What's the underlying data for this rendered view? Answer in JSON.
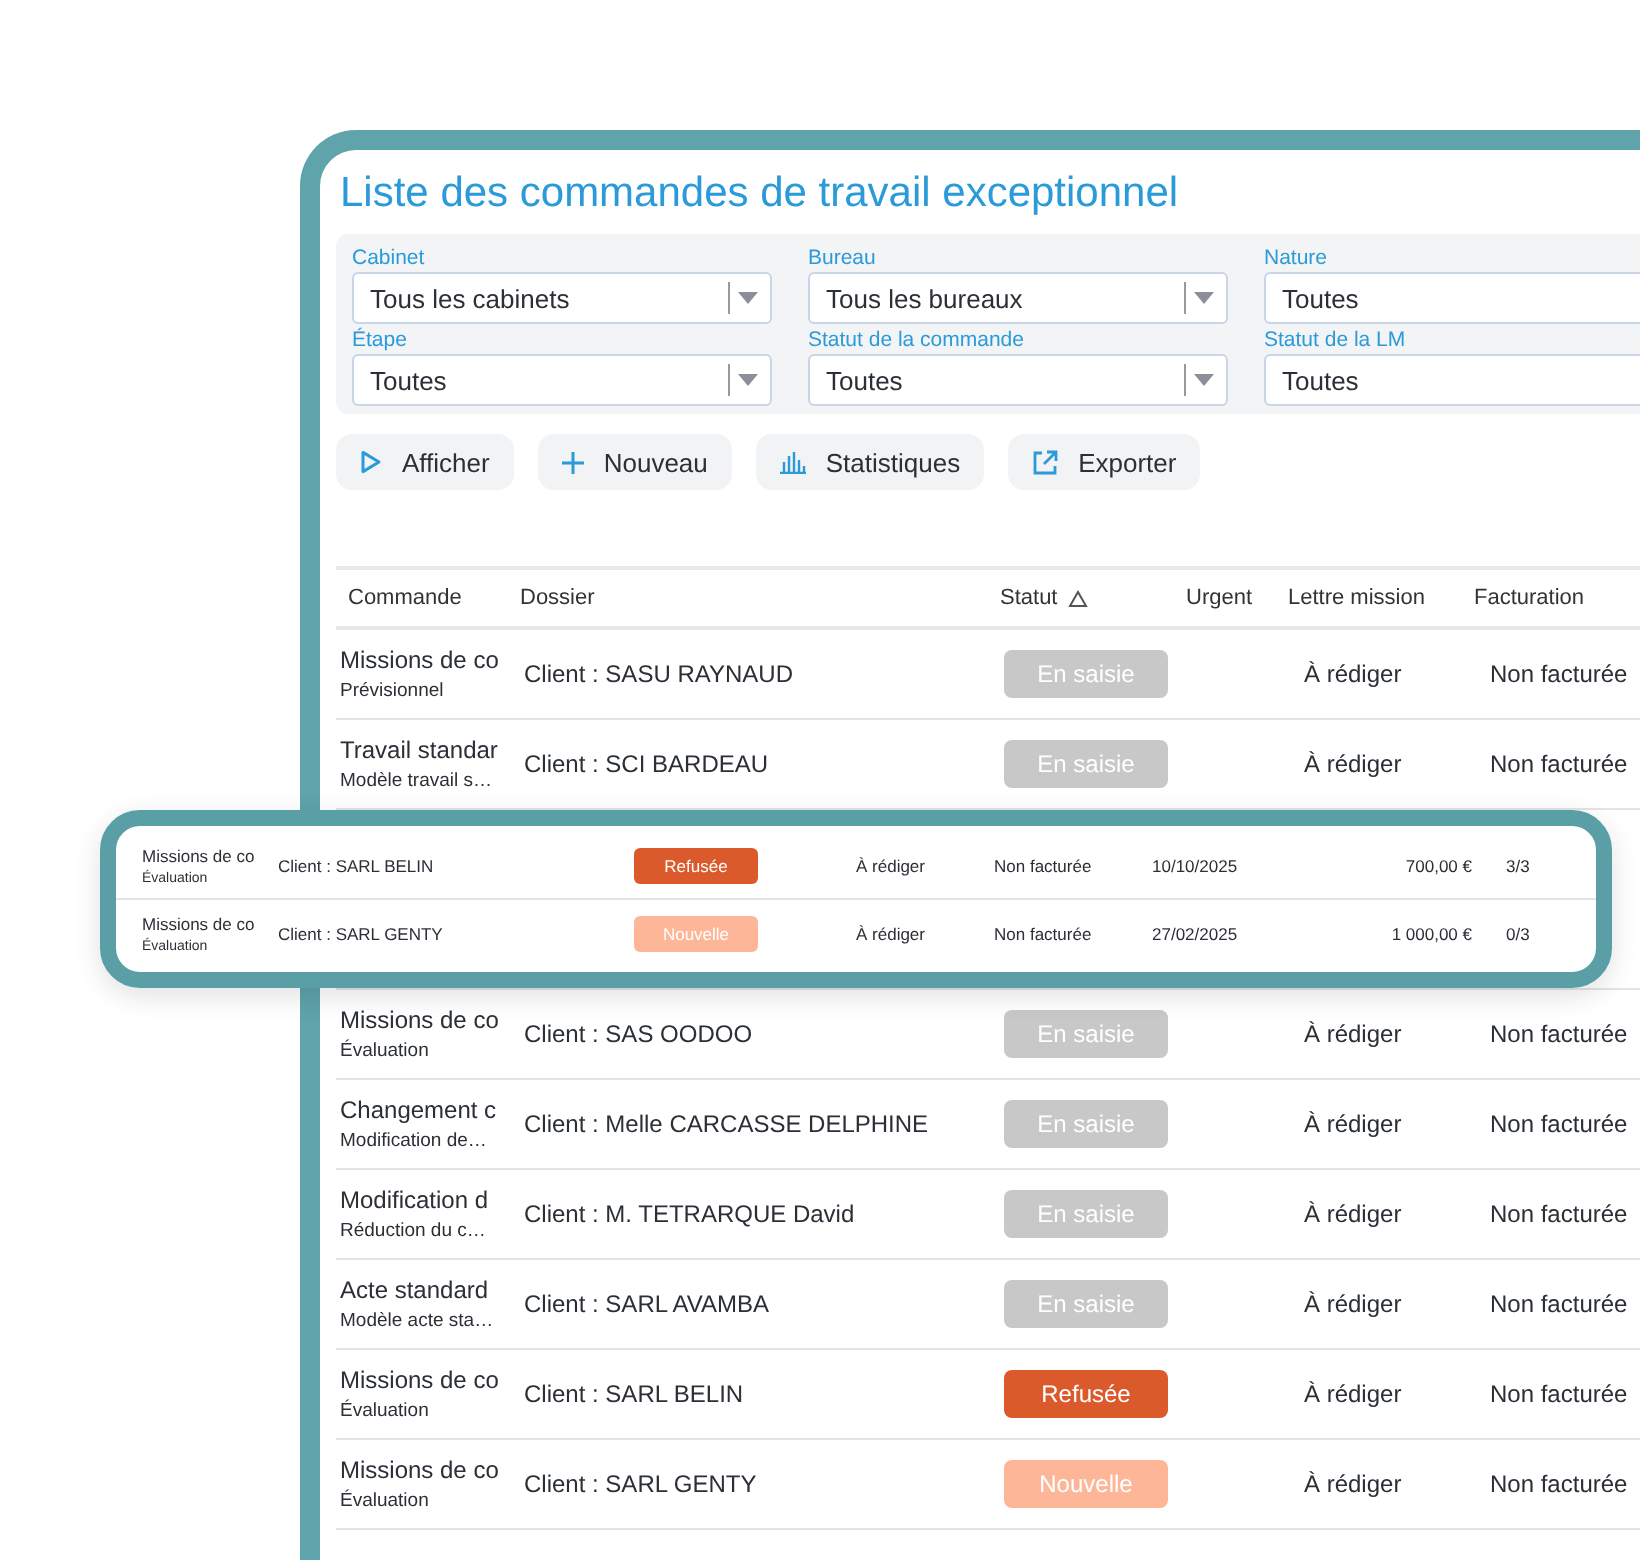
{
  "title": "Liste des commandes de travail exceptionnel",
  "filters": [
    {
      "label": "Cabinet",
      "value": "Tous les cabinets"
    },
    {
      "label": "Bureau",
      "value": "Tous les bureaux"
    },
    {
      "label": "Nature",
      "value": "Toutes"
    },
    {
      "label": "Étape",
      "value": "Toutes"
    },
    {
      "label": "Statut de la commande",
      "value": "Toutes"
    },
    {
      "label": "Statut de la LM",
      "value": "Toutes"
    }
  ],
  "actions": [
    {
      "kind": "play",
      "label": "Afficher"
    },
    {
      "kind": "plus",
      "label": "Nouveau"
    },
    {
      "kind": "chart",
      "label": "Statistiques"
    },
    {
      "kind": "export",
      "label": "Exporter"
    }
  ],
  "table": {
    "columns": [
      {
        "label": "Commande",
        "sorted": false
      },
      {
        "label": "Dossier",
        "sorted": false
      },
      {
        "label": "Statut",
        "sorted": true
      },
      {
        "label": "Urgent",
        "sorted": false
      },
      {
        "label": "Lettre mission",
        "sorted": false
      },
      {
        "label": "Facturation",
        "sorted": false
      }
    ],
    "rows_before": [
      {
        "commande": "Missions de co",
        "sub": "Prévisionnel",
        "dossier": "Client : SASU RAYNAUD",
        "status": "En saisie",
        "kind": "draft",
        "lettre": "À rédiger",
        "facturation": "Non facturée"
      },
      {
        "commande": "Travail standar",
        "sub": "Modèle travail s…",
        "dossier": "Client : SCI BARDEAU",
        "status": "En saisie",
        "kind": "draft",
        "lettre": "À rédiger",
        "facturation": "Non facturée"
      }
    ],
    "rows_after": [
      {
        "commande": "Missions de co",
        "sub": "Évaluation",
        "dossier": "Client : SAS OODOO",
        "status": "En saisie",
        "kind": "draft",
        "lettre": "À rédiger",
        "facturation": "Non facturée"
      },
      {
        "commande": "Changement c",
        "sub": "Modification de…",
        "dossier": "Client : Melle CARCASSE DELPHINE",
        "status": "En saisie",
        "kind": "draft",
        "lettre": "À rédiger",
        "facturation": "Non facturée"
      },
      {
        "commande": "Modification d",
        "sub": "Réduction du c…",
        "dossier": "Client : M. TETRARQUE David",
        "status": "En saisie",
        "kind": "draft",
        "lettre": "À rédiger",
        "facturation": "Non facturée"
      },
      {
        "commande": "Acte standard",
        "sub": "Modèle acte sta…",
        "dossier": "Client : SARL AVAMBA",
        "status": "En saisie",
        "kind": "draft",
        "lettre": "À rédiger",
        "facturation": "Non facturée"
      },
      {
        "commande": "Missions de co",
        "sub": "Évaluation",
        "dossier": "Client : SARL BELIN",
        "status": "Refusée",
        "kind": "refused",
        "lettre": "À rédiger",
        "facturation": "Non facturée"
      },
      {
        "commande": "Missions de co",
        "sub": "Évaluation",
        "dossier": "Client : SARL GENTY",
        "status": "Nouvelle",
        "kind": "new",
        "lettre": "À rédiger",
        "facturation": "Non facturée"
      }
    ]
  },
  "zoom_card": {
    "rows": [
      {
        "commande": "Missions de co",
        "sub": "Évaluation",
        "dossier": "Client : SARL BELIN",
        "status": "Refusée",
        "kind": "refused",
        "lettre": "À rédiger",
        "facturation": "Non facturée",
        "date": "10/10/2025",
        "amount": "700,00 €",
        "ratio": "3/3"
      },
      {
        "commande": "Missions de co",
        "sub": "Évaluation",
        "dossier": "Client : SARL GENTY",
        "status": "Nouvelle",
        "kind": "new",
        "lettre": "À rédiger",
        "facturation": "Non facturée",
        "date": "27/02/2025",
        "amount": "1 000,00 €",
        "ratio": "0/3"
      }
    ]
  }
}
